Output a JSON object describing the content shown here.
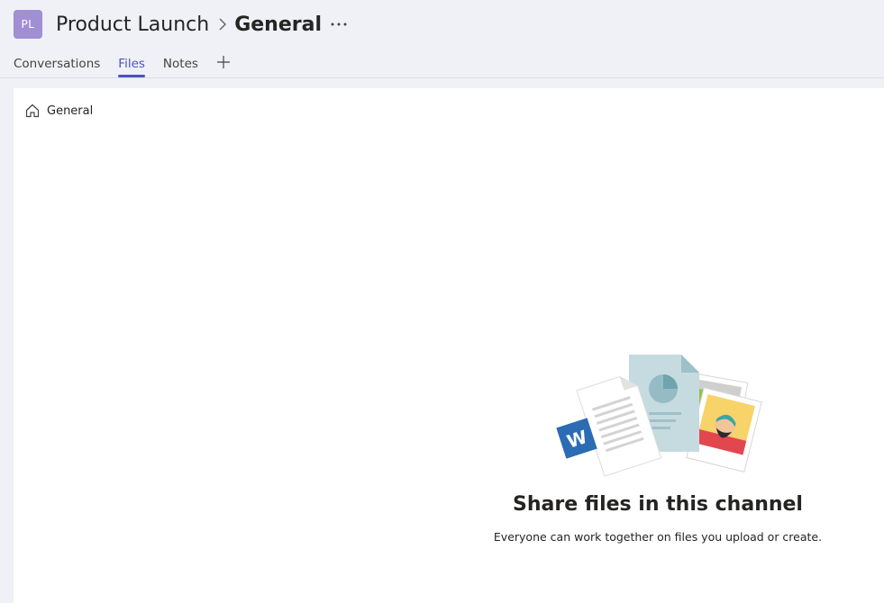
{
  "header": {
    "team_initials": "PL",
    "team_name": "Product Launch",
    "channel_name": "General",
    "more_label": "···"
  },
  "tabs": [
    {
      "label": "Conversations",
      "active": false
    },
    {
      "label": "Files",
      "active": true
    },
    {
      "label": "Notes",
      "active": false
    }
  ],
  "breadcrumb": {
    "label": "General"
  },
  "empty_state": {
    "title": "Share files in this channel",
    "subtitle": "Everyone can work together on files you upload or create.",
    "word_letter": "W"
  },
  "colors": {
    "accent": "#4b53bc",
    "avatar": "#a18fd4",
    "word_blue": "#2b6cb3"
  }
}
